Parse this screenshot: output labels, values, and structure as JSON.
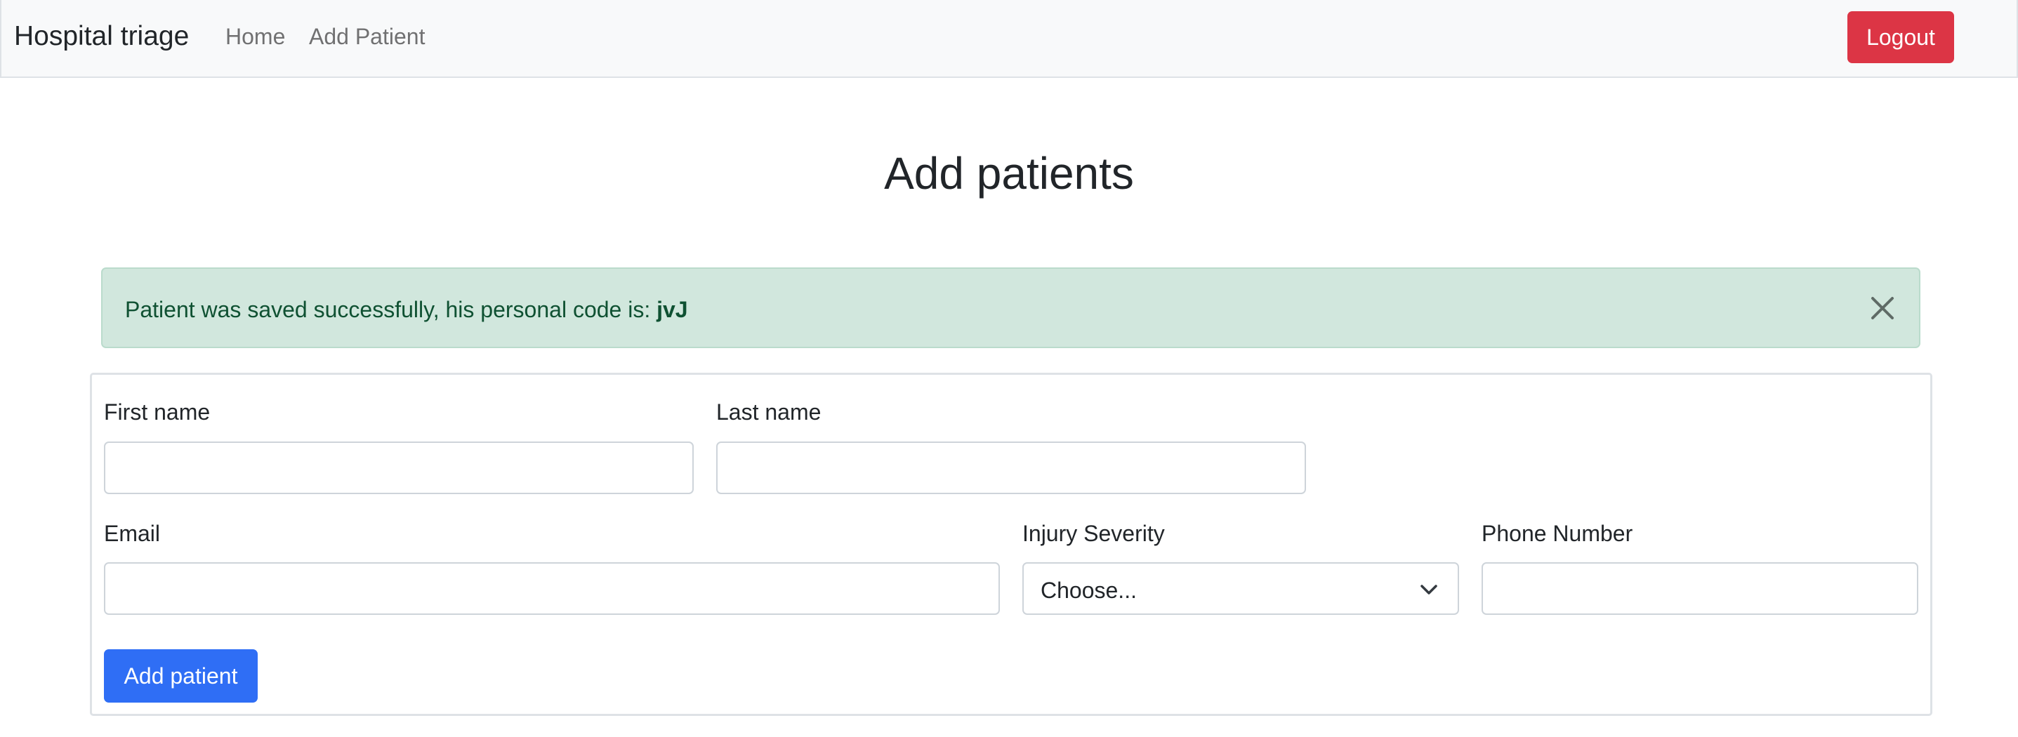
{
  "navbar": {
    "brand": "Hospital triage",
    "links": [
      "Home",
      "Add Patient"
    ],
    "logout_label": "Logout"
  },
  "page": {
    "title": "Add patients"
  },
  "alert": {
    "message": "Patient was saved successfully, his personal code is: ",
    "code": "jvJ",
    "close_icon": "close-icon"
  },
  "form": {
    "first_name": {
      "label": "First name",
      "value": ""
    },
    "last_name": {
      "label": "Last name",
      "value": ""
    },
    "email": {
      "label": "Email",
      "value": ""
    },
    "injury_severity": {
      "label": "Injury Severity",
      "selected": "Choose..."
    },
    "phone_number": {
      "label": "Phone Number",
      "value": ""
    },
    "submit_label": "Add patient"
  },
  "colors": {
    "danger": "#dc3545",
    "primary": "#2f6ef5",
    "success_bg": "#d1e7dd",
    "success_text": "#0f5132"
  }
}
